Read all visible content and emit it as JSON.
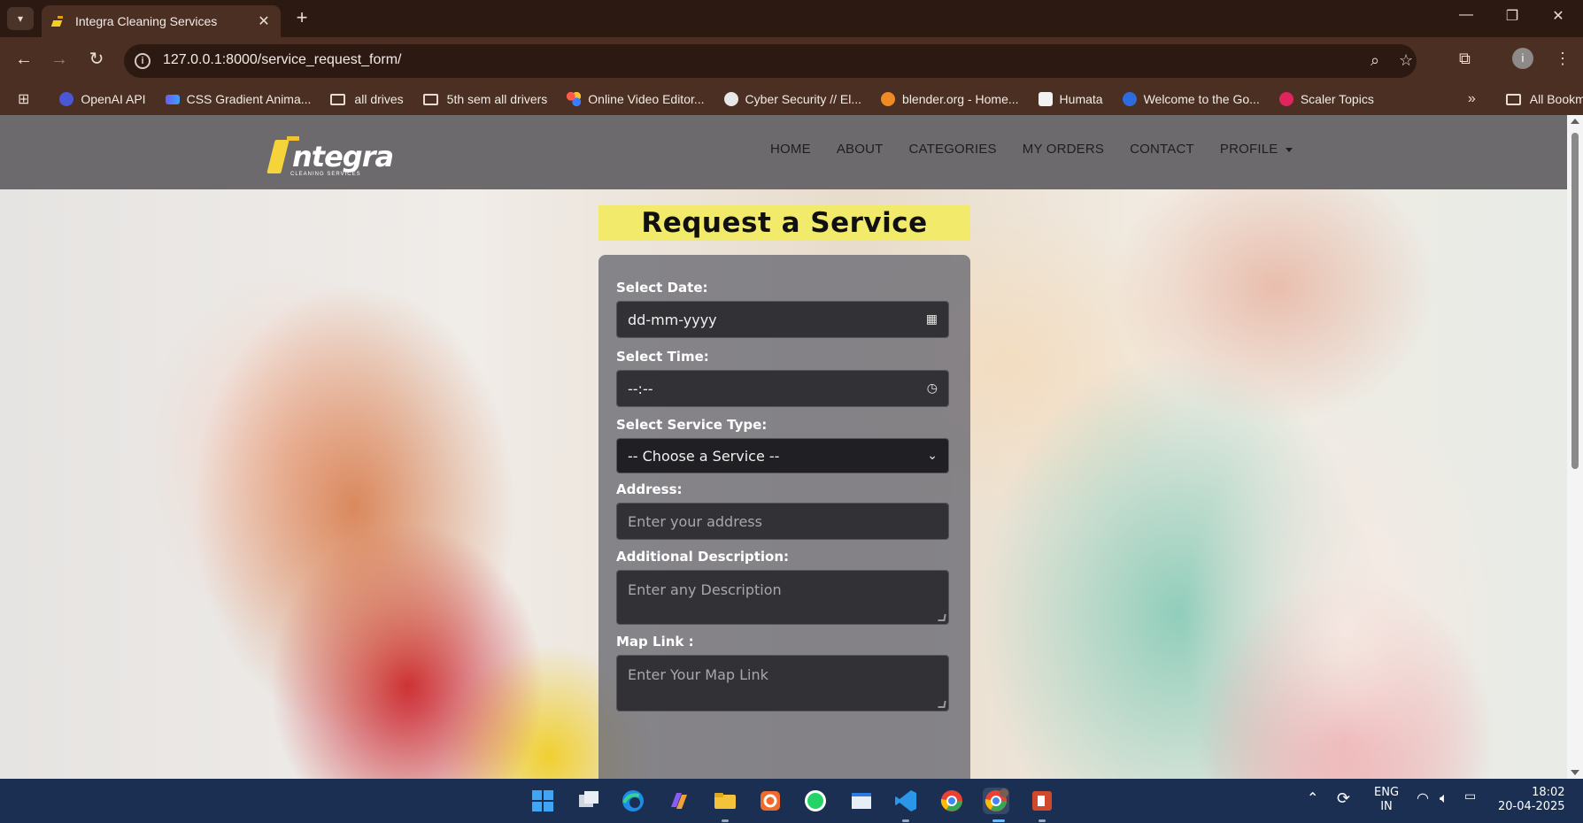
{
  "browser": {
    "tab_title": "Integra Cleaning Services",
    "url": "127.0.0.1:8000/service_request_form/",
    "bookmarks": [
      {
        "label": "OpenAI API",
        "icon": "openai-icon"
      },
      {
        "label": "CSS Gradient Anima...",
        "icon": "gradient-icon"
      },
      {
        "label": "all drives",
        "icon": "folder-icon"
      },
      {
        "label": "5th sem all drivers",
        "icon": "folder-icon"
      },
      {
        "label": "Online Video Editor...",
        "icon": "video-editor-icon"
      },
      {
        "label": "Cyber Security // El...",
        "icon": "cyber-icon"
      },
      {
        "label": "blender.org - Home...",
        "icon": "blender-icon"
      },
      {
        "label": "Humata",
        "icon": "humata-icon"
      },
      {
        "label": "Welcome to the Go...",
        "icon": "go-icon"
      },
      {
        "label": "Scaler Topics",
        "icon": "scaler-icon"
      }
    ],
    "all_bookmarks": "All Bookmarks",
    "profile_initial": "i"
  },
  "site": {
    "logo_text": "ntegra",
    "logo_sub": "CLEANING SERVICES",
    "nav": [
      "HOME",
      "ABOUT",
      "CATEGORIES",
      "MY ORDERS",
      "CONTACT",
      "PROFILE"
    ]
  },
  "form": {
    "title": "Request a Service",
    "date_label": "Select Date:",
    "date_value": "dd-mm-yyyy",
    "time_label": "Select Time:",
    "time_value": "--:--",
    "service_label": "Select Service Type:",
    "service_selected": "-- Choose a Service --",
    "address_label": "Address:",
    "address_placeholder": "Enter your address",
    "description_label": "Additional Description:",
    "description_placeholder": "Enter any Description",
    "map_label": "Map Link :",
    "map_placeholder": "Enter Your Map Link"
  },
  "taskbar": {
    "lang_top": "ENG",
    "lang_bottom": "IN",
    "time": "18:02",
    "date": "20-04-2025"
  },
  "colors": {
    "title_bg": "#f1ea6b",
    "header_bg": "#6c6a6d",
    "taskbar_bg": "#1a2f52",
    "chrome_bg": "#4a2f22"
  }
}
